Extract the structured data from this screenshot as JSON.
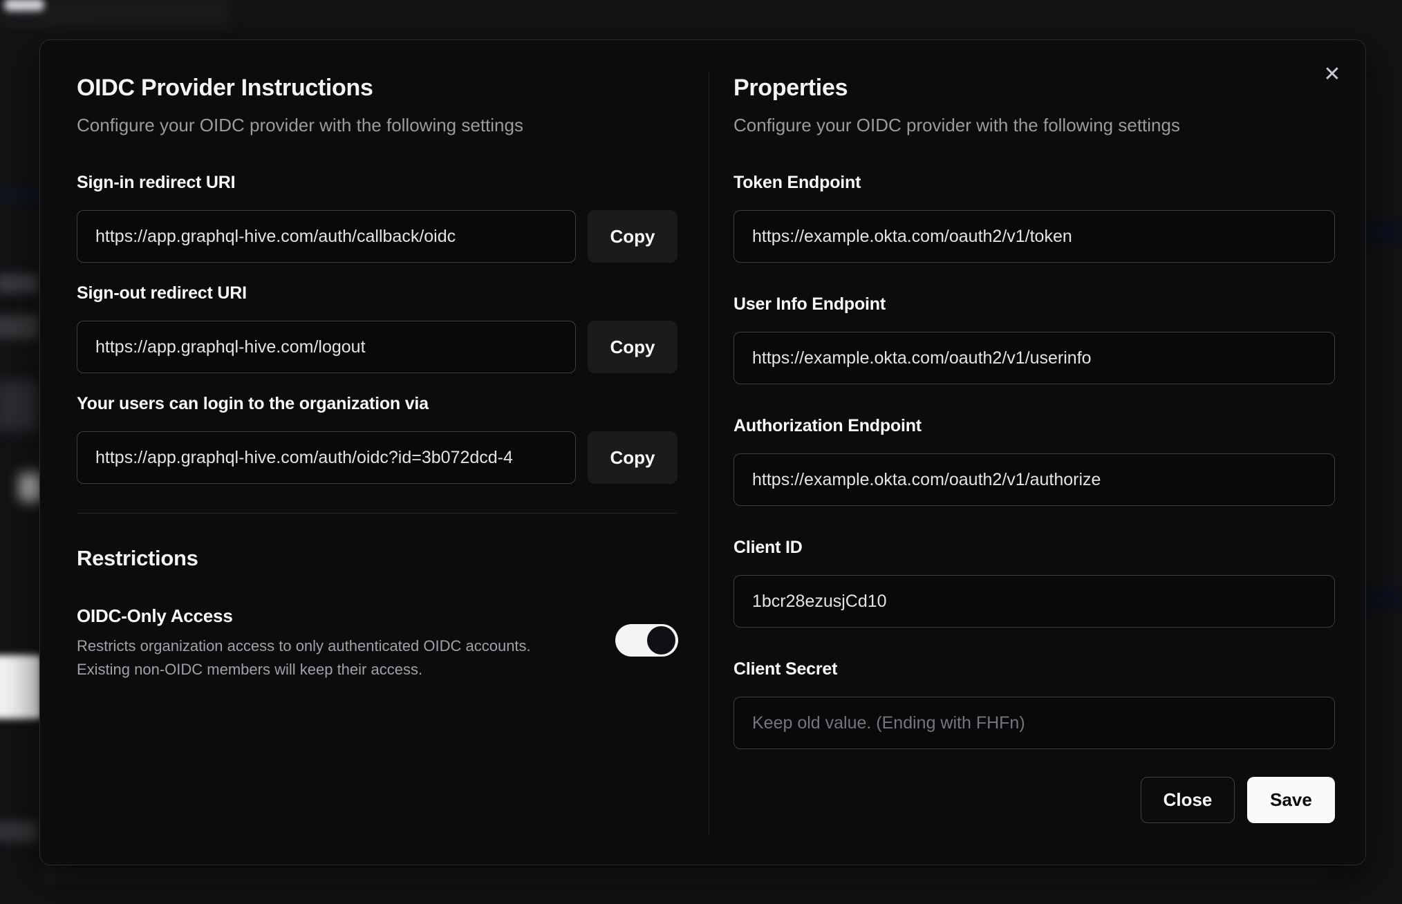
{
  "modal": {
    "close_icon": "✕",
    "left": {
      "title": "OIDC Provider Instructions",
      "subtitle": "Configure your OIDC provider with the following settings",
      "fields": [
        {
          "label": "Sign-in redirect URI",
          "value": "https://app.graphql-hive.com/auth/callback/oidc",
          "copy_label": "Copy"
        },
        {
          "label": "Sign-out redirect URI",
          "value": "https://app.graphql-hive.com/logout",
          "copy_label": "Copy"
        },
        {
          "label": "Your users can login to the organization via",
          "value": "https://app.graphql-hive.com/auth/oidc?id=3b072dcd-4",
          "copy_label": "Copy"
        }
      ],
      "restrictions": {
        "title": "Restrictions",
        "toggle_label": "OIDC-Only Access",
        "toggle_description_line1": "Restricts organization access to only authenticated OIDC accounts.",
        "toggle_description_line2": "Existing non-OIDC members will keep their access.",
        "toggle_state": "on"
      }
    },
    "right": {
      "title": "Properties",
      "subtitle": "Configure your OIDC provider with the following settings",
      "fields": [
        {
          "label": "Token Endpoint",
          "value": "https://example.okta.com/oauth2/v1/token"
        },
        {
          "label": "User Info Endpoint",
          "value": "https://example.okta.com/oauth2/v1/userinfo"
        },
        {
          "label": "Authorization Endpoint",
          "value": "https://example.okta.com/oauth2/v1/authorize"
        },
        {
          "label": "Client ID",
          "value": "1bcr28ezusjCd10"
        },
        {
          "label": "Client Secret",
          "value": "",
          "placeholder": "Keep old value. (Ending with FHFn)"
        }
      ],
      "buttons": {
        "close": "Close",
        "save": "Save"
      }
    },
    "colors": {
      "modal_background": "#0c0c0e",
      "page_background": "#131316",
      "input_border": "#413e3c",
      "toggle_on_track": "#f4f4f5",
      "toggle_knob": "#101014",
      "save_button_background": "#fafafa",
      "save_button_text": "#09090b",
      "label_text": "#fafafa",
      "muted_text": "#9b9b9e"
    }
  }
}
